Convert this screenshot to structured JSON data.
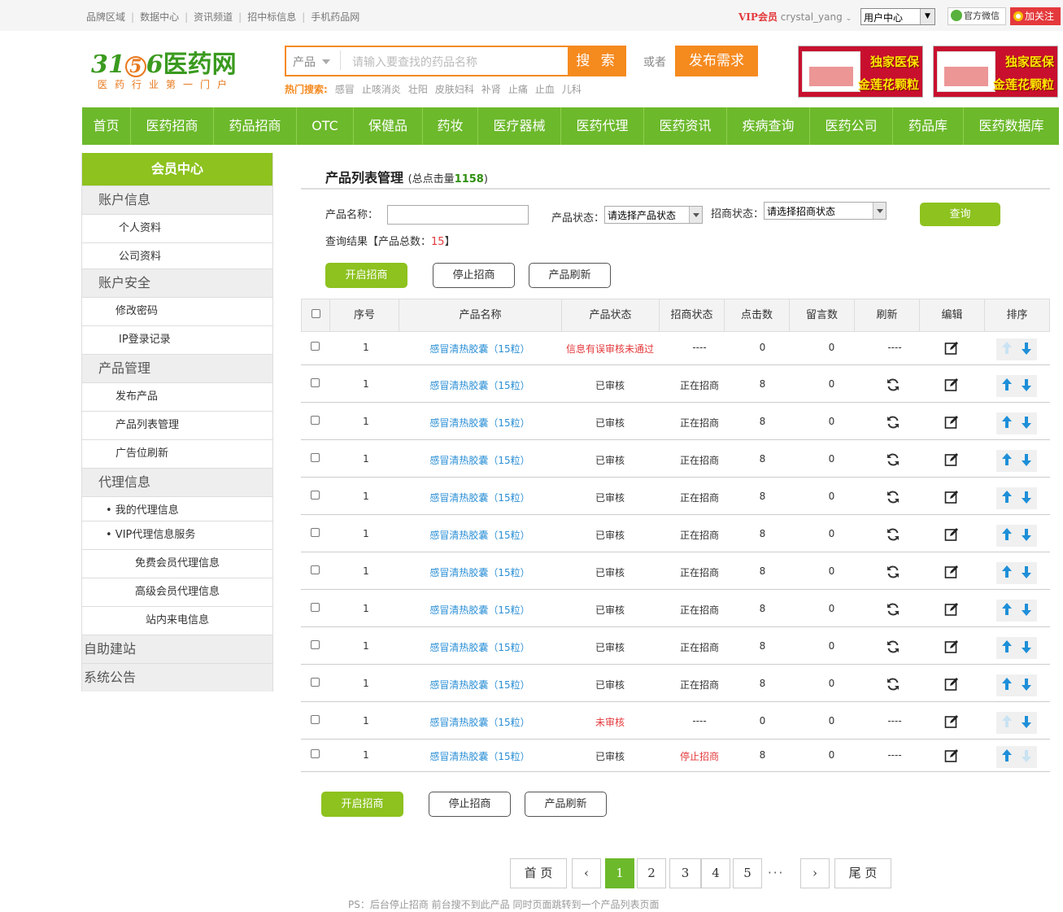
{
  "topbar": {
    "links": [
      "品牌区域",
      "数据中心",
      "资讯频道",
      "招中标信息",
      "手机药品网"
    ],
    "vip_label": "VIP会员",
    "username": "crystal_yang",
    "user_menu": "用户中心",
    "wechat": "官方微信",
    "weibo": "加关注"
  },
  "header": {
    "logo_num1": "31",
    "logo_circle": "5",
    "logo_num2": "6",
    "logo_cn": "医药网",
    "slogan": "医药行业第一门户",
    "search_category": "产品",
    "search_placeholder": "请输入要查找的药品名称",
    "search_button": "搜 索",
    "or": "或者",
    "publish_button": "发布需求",
    "hot_label": "热门搜索:",
    "hot_terms": [
      "感冒",
      "止咳消炎",
      "壮阳",
      "皮肤妇科",
      "补肾",
      "止痛",
      "止血",
      "儿科"
    ],
    "ads": [
      {
        "line1": "独家医保",
        "line2": "金莲花颗粒"
      },
      {
        "line1": "独家医保",
        "line2": "金莲花颗粒"
      }
    ]
  },
  "nav": [
    "首页",
    "医药招商",
    "药品招商",
    "OTC",
    "保健品",
    "药妆",
    "医疗器械",
    "医药代理",
    "医药资讯",
    "疾病查询",
    "医药公司",
    "药品库",
    "医药数据库"
  ],
  "sidebar": {
    "title": "会员中心",
    "g1": "账户信息",
    "i1": "个人资料",
    "i2": "公司资料",
    "g2": "账户安全",
    "i3": "修改密码",
    "i4": "IP登录记录",
    "g3": "产品管理",
    "i5": "发布产品",
    "i6": "产品列表管理",
    "i7": "广告位刷新",
    "g4": "代理信息",
    "i8": "• 我的代理信息",
    "i9": "• VIP代理信息服务",
    "i10": "免费会员代理信息",
    "i11": "高级会员代理信息",
    "i12": "站内来电信息",
    "g5": "自助建站",
    "g6": "系统公告"
  },
  "main": {
    "title": "产品列表管理",
    "total_clicks_label": "(总点击量",
    "total_clicks": "1158",
    "total_clicks_end": ")",
    "name_label": "产品名称：",
    "status_label": "产品状态：",
    "status_value": "请选择产品状态",
    "zs_label": "招商状态：",
    "zs_value": "请选择招商状态",
    "query_button": "查询",
    "result_label": "查询结果【产品总数：",
    "result_count": "15",
    "result_end": "】",
    "btn_start": "开启招商",
    "btn_stop": "停止招商",
    "btn_refresh": "产品刷新"
  },
  "table": {
    "headers": [
      "序号",
      "产品名称",
      "产品状态",
      "招商状态",
      "点击数",
      "留言数",
      "刷新",
      "编辑",
      "排序"
    ],
    "rows": [
      {
        "no": "1",
        "name": "感冒清热胶囊（15粒）",
        "status": "信息有误审核未通过",
        "status_red": true,
        "zs": "----",
        "zs_red": false,
        "clicks": "0",
        "msgs": "0",
        "refresh": false,
        "up": false,
        "down": true
      },
      {
        "no": "1",
        "name": "感冒清热胶囊（15粒）",
        "status": "已审核",
        "status_red": false,
        "zs": "正在招商",
        "zs_red": false,
        "clicks": "8",
        "msgs": "0",
        "refresh": true,
        "up": true,
        "down": true
      },
      {
        "no": "1",
        "name": "感冒清热胶囊（15粒）",
        "status": "已审核",
        "status_red": false,
        "zs": "正在招商",
        "zs_red": false,
        "clicks": "8",
        "msgs": "0",
        "refresh": true,
        "up": true,
        "down": true
      },
      {
        "no": "1",
        "name": "感冒清热胶囊（15粒）",
        "status": "已审核",
        "status_red": false,
        "zs": "正在招商",
        "zs_red": false,
        "clicks": "8",
        "msgs": "0",
        "refresh": true,
        "up": true,
        "down": true
      },
      {
        "no": "1",
        "name": "感冒清热胶囊（15粒）",
        "status": "已审核",
        "status_red": false,
        "zs": "正在招商",
        "zs_red": false,
        "clicks": "8",
        "msgs": "0",
        "refresh": true,
        "up": true,
        "down": true
      },
      {
        "no": "1",
        "name": "感冒清热胶囊（15粒）",
        "status": "已审核",
        "status_red": false,
        "zs": "正在招商",
        "zs_red": false,
        "clicks": "8",
        "msgs": "0",
        "refresh": true,
        "up": true,
        "down": true
      },
      {
        "no": "1",
        "name": "感冒清热胶囊（15粒）",
        "status": "已审核",
        "status_red": false,
        "zs": "正在招商",
        "zs_red": false,
        "clicks": "8",
        "msgs": "0",
        "refresh": true,
        "up": true,
        "down": true
      },
      {
        "no": "1",
        "name": "感冒清热胶囊（15粒）",
        "status": "已审核",
        "status_red": false,
        "zs": "正在招商",
        "zs_red": false,
        "clicks": "8",
        "msgs": "0",
        "refresh": true,
        "up": true,
        "down": true
      },
      {
        "no": "1",
        "name": "感冒清热胶囊（15粒）",
        "status": "已审核",
        "status_red": false,
        "zs": "正在招商",
        "zs_red": false,
        "clicks": "8",
        "msgs": "0",
        "refresh": true,
        "up": true,
        "down": true
      },
      {
        "no": "1",
        "name": "感冒清热胶囊（15粒）",
        "status": "已审核",
        "status_red": false,
        "zs": "正在招商",
        "zs_red": false,
        "clicks": "8",
        "msgs": "0",
        "refresh": true,
        "up": true,
        "down": true
      },
      {
        "no": "1",
        "name": "感冒清热胶囊（15粒）",
        "status": "未审核",
        "status_red": true,
        "zs": "----",
        "zs_red": false,
        "clicks": "0",
        "msgs": "0",
        "refresh": false,
        "up": false,
        "down": true
      },
      {
        "no": "1",
        "name": "感冒清热胶囊（15粒）",
        "status": "已审核",
        "status_red": false,
        "zs": "停止招商",
        "zs_red": true,
        "clicks": "8",
        "msgs": "0",
        "refresh": false,
        "up": true,
        "down": false
      }
    ],
    "no_refresh": "----"
  },
  "pagination": {
    "first": "首 页",
    "prev": "‹",
    "pages": [
      "1",
      "2",
      "3",
      "4",
      "5"
    ],
    "current": "1",
    "ellipsis": "···",
    "next": "›",
    "last": "尾 页"
  },
  "note": "PS：后台停止招商  前台搜不到此产品 同时页面跳转到一个产品列表页面",
  "colors": {
    "brand_green": "#6cb92b",
    "accent_orange": "#f58a1f",
    "link_blue": "#2b8fd6",
    "alert_red": "#e4393c"
  }
}
